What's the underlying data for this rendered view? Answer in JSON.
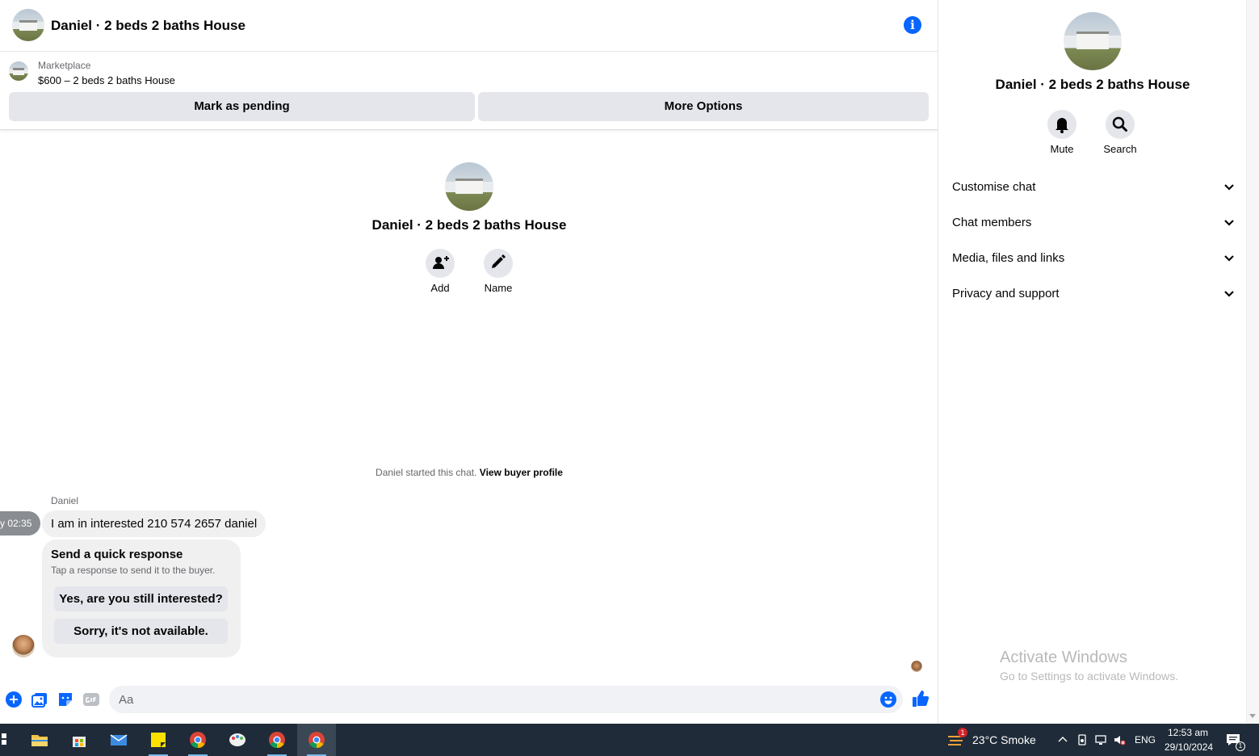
{
  "header": {
    "title": "Daniel · 2 beds 2 baths House",
    "info_glyph": "i"
  },
  "listing": {
    "source": "Marketplace",
    "title": "$600 – 2 beds 2 baths House",
    "pending_label": "Mark as pending",
    "options_label": "More Options"
  },
  "profile": {
    "name": "Daniel · 2 beds 2 baths House",
    "add_label": "Add",
    "name_label": "Name"
  },
  "chat": {
    "started_text": "Daniel started this chat.",
    "view_profile_label": "View buyer profile",
    "messages": [
      {
        "sender": "Daniel",
        "time": "y 02:35",
        "text": "I am in interested 210 574 2657 daniel"
      }
    ],
    "quick_response": {
      "title": "Send a quick response",
      "subtitle": "Tap a response to send it to the buyer.",
      "options": [
        "Yes, are you still interested?",
        "Sorry, it's not available."
      ]
    }
  },
  "composer": {
    "placeholder": "Aa",
    "value": ""
  },
  "details": {
    "name": "Daniel · 2 beds 2 baths House",
    "mute_label": "Mute",
    "search_label": "Search",
    "sections": [
      "Customise chat",
      "Chat members",
      "Media, files and links",
      "Privacy and support"
    ]
  },
  "watermark": {
    "title": "Activate Windows",
    "subtitle": "Go to Settings to activate Windows."
  },
  "taskbar": {
    "weather_badge": "1",
    "weather": "23°C  Smoke",
    "language": "ENG",
    "time": "12:53 am",
    "date": "29/10/2024",
    "notification_count": "1"
  },
  "colors": {
    "accent": "#0866ff",
    "button_bg": "#e4e6eb",
    "bubble_bg": "#f0f0f0",
    "taskbar_bg": "#1f2b38"
  }
}
